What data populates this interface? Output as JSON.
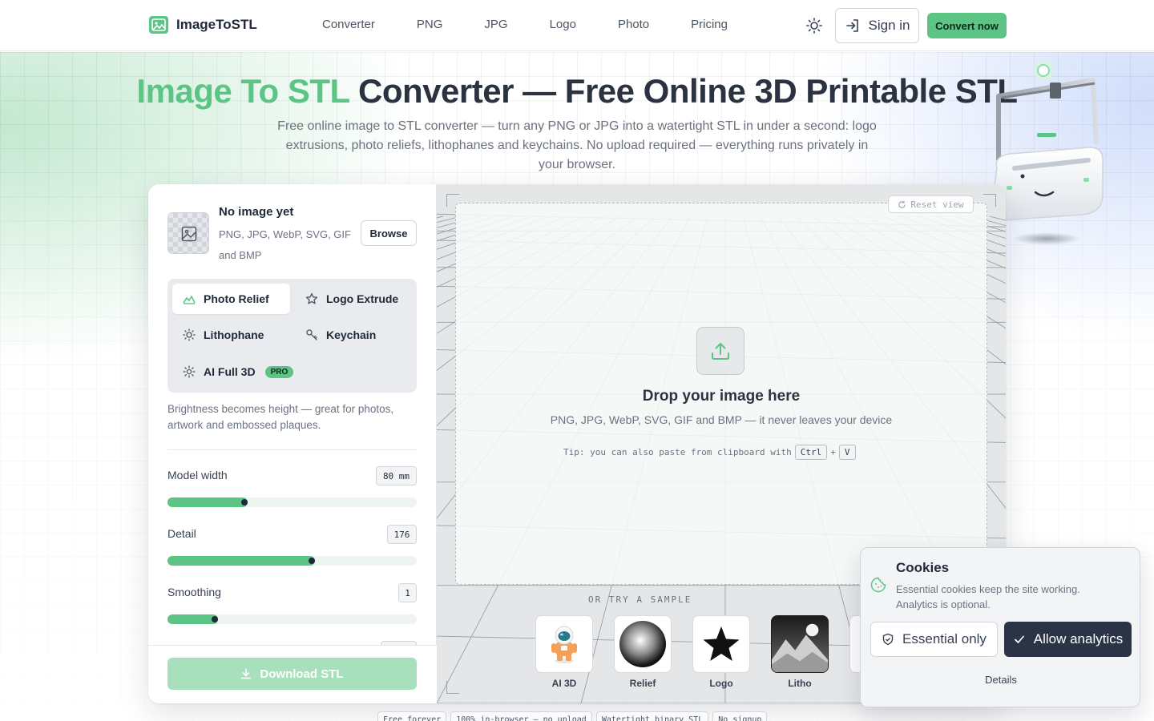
{
  "header": {
    "brand": "ImageToSTL",
    "nav": [
      "Converter",
      "PNG",
      "JPG",
      "Logo",
      "Photo",
      "Pricing"
    ],
    "signin_label": "Sign in",
    "convert_label": "Convert now"
  },
  "hero": {
    "title_accent": "Image To STL",
    "title_rest": " Converter — Free Online 3D Printable STL",
    "subtitle": "Free online image to STL converter — turn any PNG or JPG into a watertight STL in under a second: logo extrusions, photo reliefs, lithophanes and keychains. No upload required — everything runs privately in your browser."
  },
  "panel": {
    "no_image_title": "No image yet",
    "formats": "PNG, JPG, WebP, SVG, GIF and BMP",
    "browse_label": "Browse",
    "modes": [
      {
        "label": "Photo Relief",
        "icon": "mountain-icon",
        "active": true
      },
      {
        "label": "Logo Extrude",
        "icon": "star-icon",
        "active": false
      },
      {
        "label": "Lithophane",
        "icon": "sun-icon",
        "active": false
      },
      {
        "label": "Keychain",
        "icon": "key-icon",
        "active": false
      },
      {
        "label": "AI Full 3D",
        "icon": "sparkle-icon",
        "active": false,
        "badge": "PRO"
      }
    ],
    "mode_description": "Brightness becomes height — great for photos, artwork and embossed plaques.",
    "sliders": [
      {
        "label": "Model width",
        "value": "80 mm",
        "fraction": 0.31
      },
      {
        "label": "Detail",
        "value": "176",
        "fraction": 0.58
      },
      {
        "label": "Smoothing",
        "value": "1",
        "fraction": 0.19
      }
    ],
    "download_label": "Download STL"
  },
  "viewport": {
    "reset_label": "Reset view",
    "drop_title": "Drop your image here",
    "drop_subtitle": "PNG, JPG, WebP, SVG, GIF and BMP — it never leaves your device",
    "tip_text": "Tip: you can also paste from clipboard with",
    "tip_keys": [
      "Ctrl",
      "V"
    ],
    "tip_plus": "+",
    "try_label": "OR TRY A SAMPLE",
    "samples": [
      {
        "label": "AI 3D",
        "icon": "astronaut-icon"
      },
      {
        "label": "Relief",
        "icon": "sphere-icon"
      },
      {
        "label": "Logo",
        "icon": "star-icon"
      },
      {
        "label": "Litho",
        "icon": "mountain-photo-icon"
      }
    ]
  },
  "chips": [
    "Free forever",
    "100% in-browser — no upload",
    "Watertight binary STL",
    "No signup"
  ],
  "cookie": {
    "title": "Cookies",
    "text": "Essential cookies keep the site working. Analytics is optional.",
    "essential_label": "Essential only",
    "allow_label": "Allow analytics",
    "details_label": "Details"
  },
  "colors": {
    "accent": "#5cc485",
    "dark": "#2b3446",
    "text": "#1f2937"
  }
}
